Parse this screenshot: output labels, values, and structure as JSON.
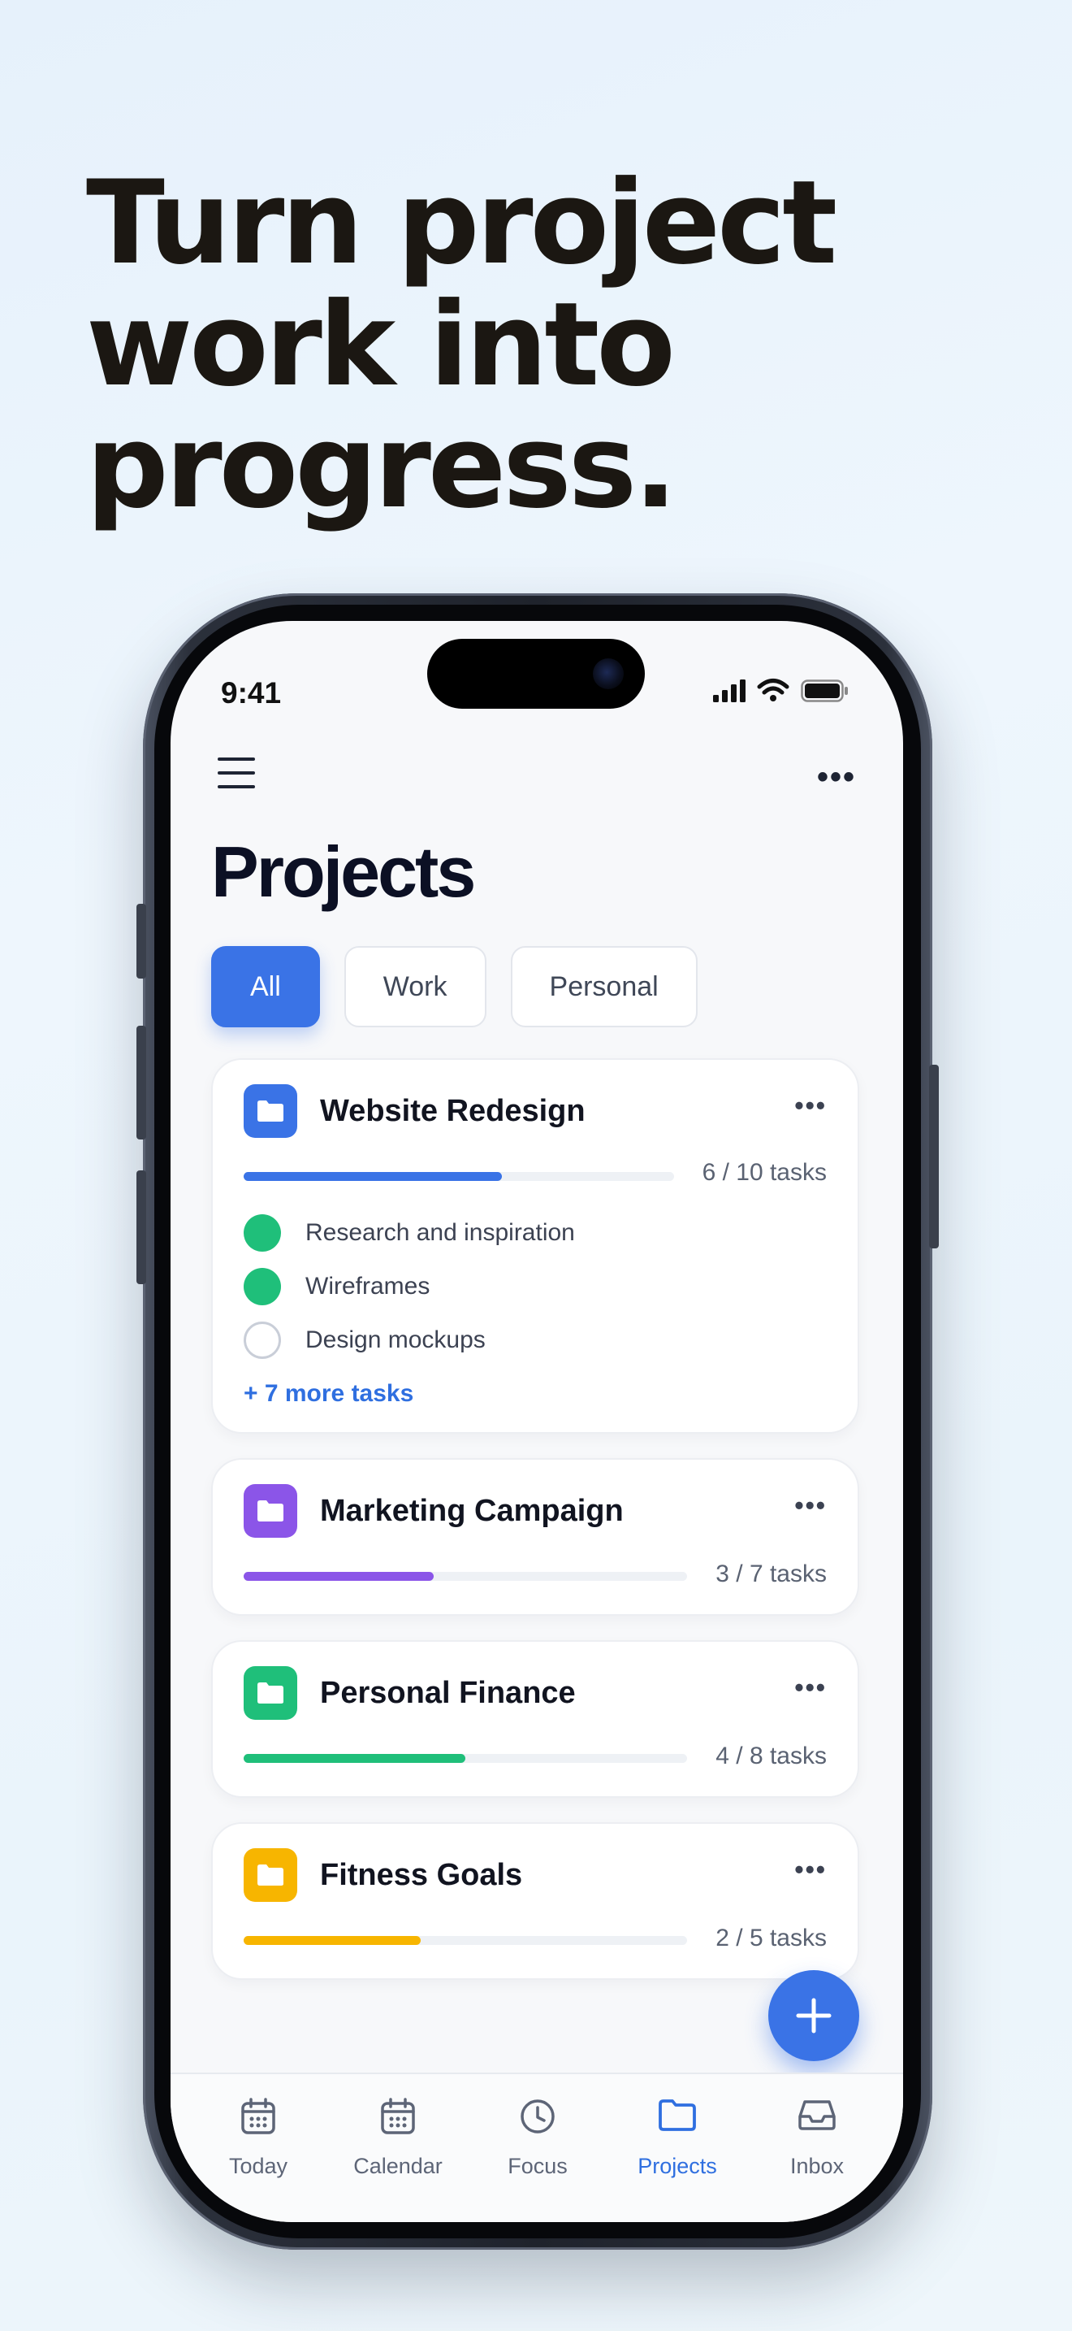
{
  "headline": {
    "line1": "Turn project",
    "line2": "work into",
    "line3": "progress."
  },
  "status_bar": {
    "time": "9:41"
  },
  "header": {
    "title": "Projects"
  },
  "filters": [
    {
      "label": "All",
      "active": true
    },
    {
      "label": "Work",
      "active": false
    },
    {
      "label": "Personal",
      "active": false
    }
  ],
  "projects": [
    {
      "name": "Website Redesign",
      "color": "#3a73e6",
      "progress": 0.6,
      "tasks_label": "6 / 10 tasks",
      "items": [
        {
          "label": "Research and inspiration",
          "done": true
        },
        {
          "label": "Wireframes",
          "done": true
        },
        {
          "label": "Design mockups",
          "done": false
        }
      ],
      "more_label": "+ 7 more tasks"
    },
    {
      "name": "Marketing Campaign",
      "color": "#8b55e8",
      "progress": 0.4286,
      "tasks_label": "3 / 7 tasks"
    },
    {
      "name": "Personal Finance",
      "color": "#1fbf7a",
      "progress": 0.5,
      "tasks_label": "4 / 8 tasks"
    },
    {
      "name": "Fitness Goals",
      "color": "#f7b500",
      "progress": 0.4,
      "tasks_label": "2 / 5 tasks"
    }
  ],
  "tabs": [
    {
      "label": "Today",
      "icon": "calendar-icon",
      "active": false
    },
    {
      "label": "Calendar",
      "icon": "calendar-icon",
      "active": false
    },
    {
      "label": "Focus",
      "icon": "clock-icon",
      "active": false
    },
    {
      "label": "Projects",
      "icon": "folder-icon",
      "active": true
    },
    {
      "label": "Inbox",
      "icon": "inbox-icon",
      "active": false
    }
  ]
}
